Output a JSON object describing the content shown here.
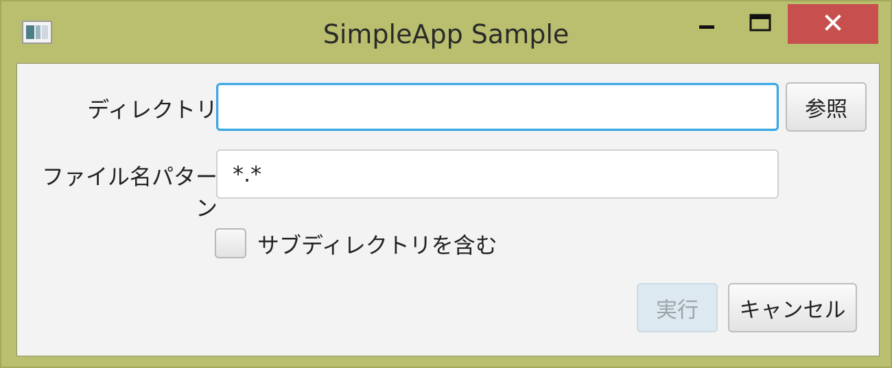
{
  "window": {
    "title": "SimpleApp Sample",
    "controls": {
      "minimize": "minimize",
      "maximize": "maximize",
      "close": "close"
    }
  },
  "form": {
    "directory_label": "ディレクトリ",
    "directory_value": "",
    "browse_label": "参照",
    "pattern_label": "ファイル名パターン",
    "pattern_value": "*.*",
    "include_subdirs_label": "サブディレクトリを含む",
    "include_subdirs_checked": false
  },
  "actions": {
    "run_label": "実行",
    "run_enabled": false,
    "cancel_label": "キャンセル"
  },
  "colors": {
    "window_frame": "#b9bf6e",
    "close_button": "#c7504e",
    "focus_border": "#3aa7e6"
  }
}
